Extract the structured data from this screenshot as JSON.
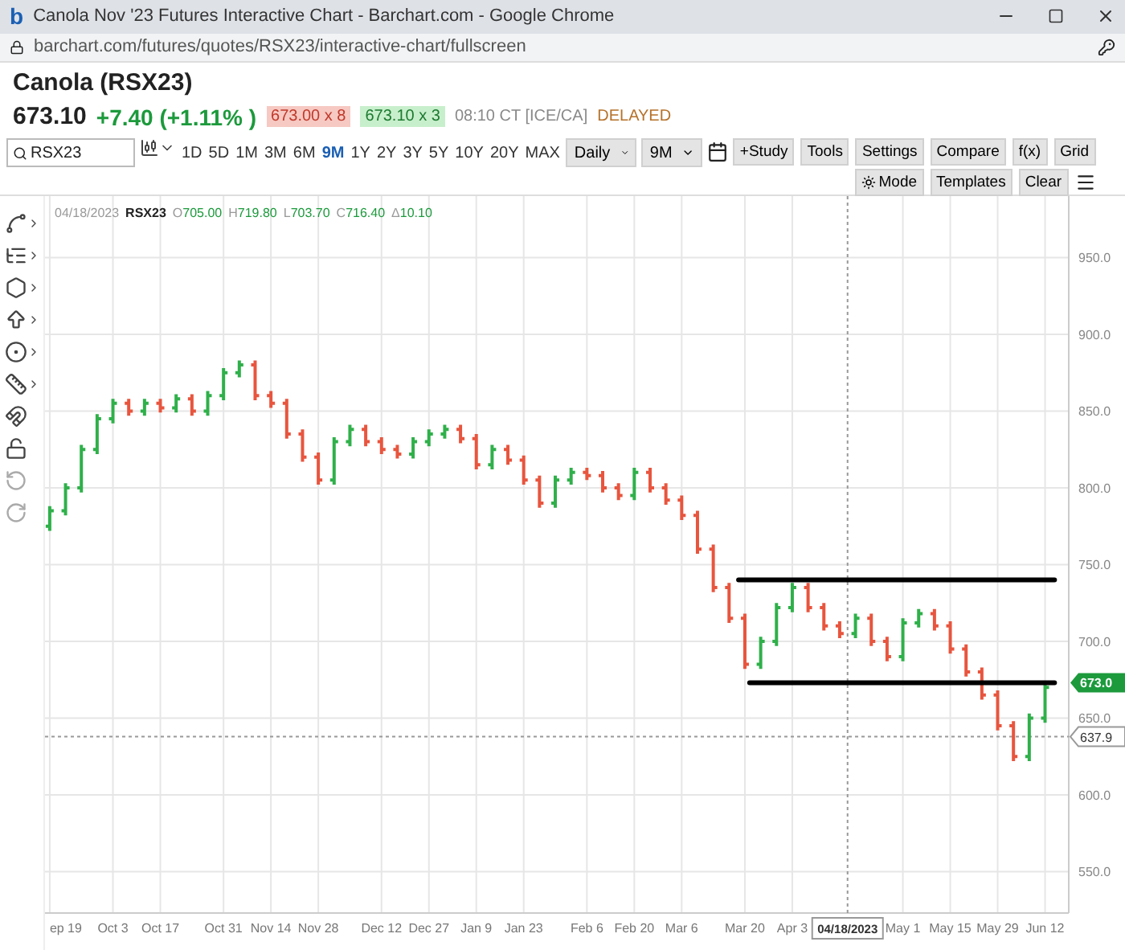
{
  "window": {
    "logo": "b",
    "title": "Canola Nov '23 Futures Interactive Chart - Barchart.com - Google Chrome",
    "url": "barchart.com/futures/quotes/RSX23/interactive-chart/fullscreen"
  },
  "quote": {
    "name": "Canola (RSX23)",
    "last": "673.10",
    "change": "+7.40 (+1.11% )",
    "bid": "673.00 x 8",
    "ask": "673.10 x 3",
    "time": "08:10 CT [ICE/CA]",
    "status": "DELAYED"
  },
  "toolbar": {
    "search": "RSX23",
    "periods": [
      {
        "label": "1D",
        "selected": false
      },
      {
        "label": "5D",
        "selected": false
      },
      {
        "label": "1M",
        "selected": false
      },
      {
        "label": "3M",
        "selected": false
      },
      {
        "label": "6M",
        "selected": false
      },
      {
        "label": "9M",
        "selected": true
      },
      {
        "label": "1Y",
        "selected": false
      },
      {
        "label": "2Y",
        "selected": false
      },
      {
        "label": "3Y",
        "selected": false
      },
      {
        "label": "5Y",
        "selected": false
      },
      {
        "label": "10Y",
        "selected": false
      },
      {
        "label": "20Y",
        "selected": false
      },
      {
        "label": "MAX",
        "selected": false
      }
    ],
    "dropdowns": [
      "Daily",
      "9M"
    ],
    "buttons_row1": [
      "+Study",
      "Tools",
      "Settings",
      "Compare",
      "f(x)",
      "Grid"
    ],
    "buttons_row2": [
      "Mode",
      "Templates",
      "Clear"
    ]
  },
  "legend": {
    "date": "04/18/2023",
    "symbol": "RSX23",
    "fields": [
      {
        "label": "O",
        "value": "705.00"
      },
      {
        "label": "H",
        "value": "719.80"
      },
      {
        "label": "L",
        "value": "703.70"
      },
      {
        "label": "C",
        "value": "716.40"
      },
      {
        "label": "Δ",
        "value": "10.10"
      }
    ]
  },
  "chart": {
    "crosshair_label": "04/18/2023",
    "price_label": "637.9",
    "last_label": "673.0",
    "y_labels": [
      "950.0",
      "900.0",
      "850.0",
      "800.0",
      "750.0",
      "700.0",
      "650.0",
      "600.0",
      "550.0"
    ],
    "x_labels": [
      "ep 19",
      "Oct 3",
      "Oct 17",
      "Oct 31",
      "Nov 14",
      "Nov 28",
      "Dec 12",
      "Dec 27",
      "Jan 9",
      "Jan 23",
      "Feb 6",
      "Feb 20",
      "Mar 6",
      "Mar 20",
      "Apr 3",
      "May 1",
      "May 15",
      "May 29",
      "Jun 12"
    ]
  }
}
